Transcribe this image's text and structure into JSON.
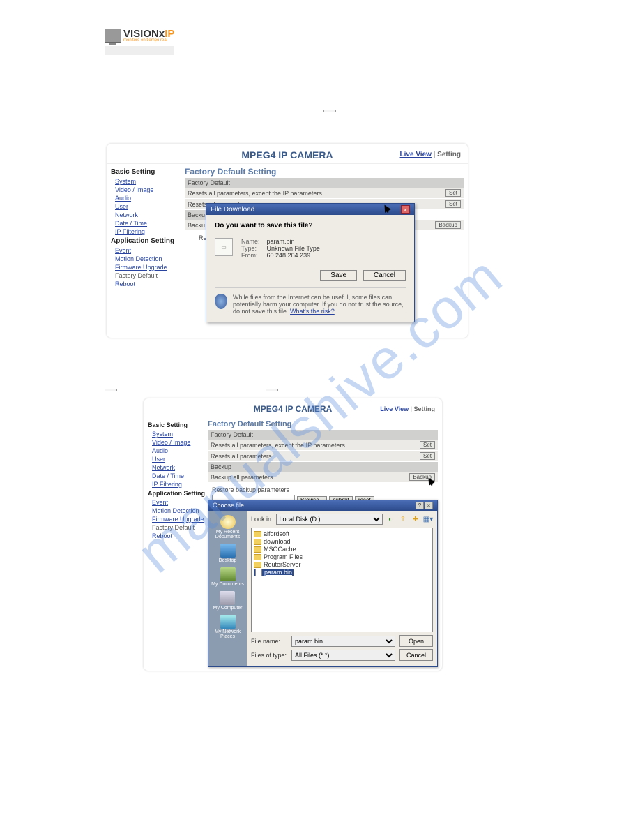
{
  "watermark": "manualshive.com",
  "logo": {
    "name1": "VISION",
    "x": "x",
    "ip": "IP",
    "tagline": "monitore en tiempo real"
  },
  "body1_btn": " ",
  "body2_btn1": " ",
  "body2_btn2": " ",
  "camera": {
    "title": "MPEG4 IP CAMERA",
    "links": {
      "live": "Live View",
      "sep": " | ",
      "setting": "Setting"
    },
    "sidebar": {
      "sec1": "Basic Setting",
      "items1": [
        "System",
        "Video / Image",
        "Audio",
        "User",
        "Network",
        "Date / Time",
        "IP Filtering"
      ],
      "sec2": "Application Setting",
      "items2": [
        "Event",
        "Motion Detection",
        "Firmware Upgrade"
      ],
      "current": "Factory Default",
      "reboot": "Reboot"
    },
    "content": {
      "title": "Factory Default Setting",
      "sec_fd": "Factory Default",
      "row1": "Resets all parameters, except the IP parameters",
      "row2": "Resets all parameters",
      "set": "Set",
      "sec_bk": "Backup",
      "row3": "Backup all parameters",
      "backup": "Backup",
      "restore_label": "Restore backup parameters",
      "browse": "Browse...",
      "submit": "submit",
      "reset": "reset"
    }
  },
  "download_dlg": {
    "title": "File Download",
    "question": "Do you want to save this file?",
    "name_lbl": "Name:",
    "name_val": "param.bin",
    "type_lbl": "Type:",
    "type_val": "Unknown File Type",
    "from_lbl": "From:",
    "from_val": "60.248.204.239",
    "save": "Save",
    "cancel": "Cancel",
    "warn": "While files from the Internet can be useful, some files can potentially harm your computer. If you do not trust the source, do not save this file. ",
    "risk": "What's the risk?"
  },
  "choose_dlg": {
    "title": "Choose file",
    "lookin": "Look in:",
    "drive": "Local Disk (D:)",
    "places": {
      "recent": "My Recent Documents",
      "desktop": "Desktop",
      "docs": "My Documents",
      "computer": "My Computer",
      "network": "My Network Places"
    },
    "folders": [
      "alfordsoft",
      "download",
      "MSOCache",
      "Program Files",
      "RouterServer"
    ],
    "selected_file": "param.bin",
    "fn_lbl": "File name:",
    "fn_val": "param.bin",
    "ft_lbl": "Files of type:",
    "ft_val": "All Files (*.*)",
    "open": "Open",
    "cancel": "Cancel"
  }
}
